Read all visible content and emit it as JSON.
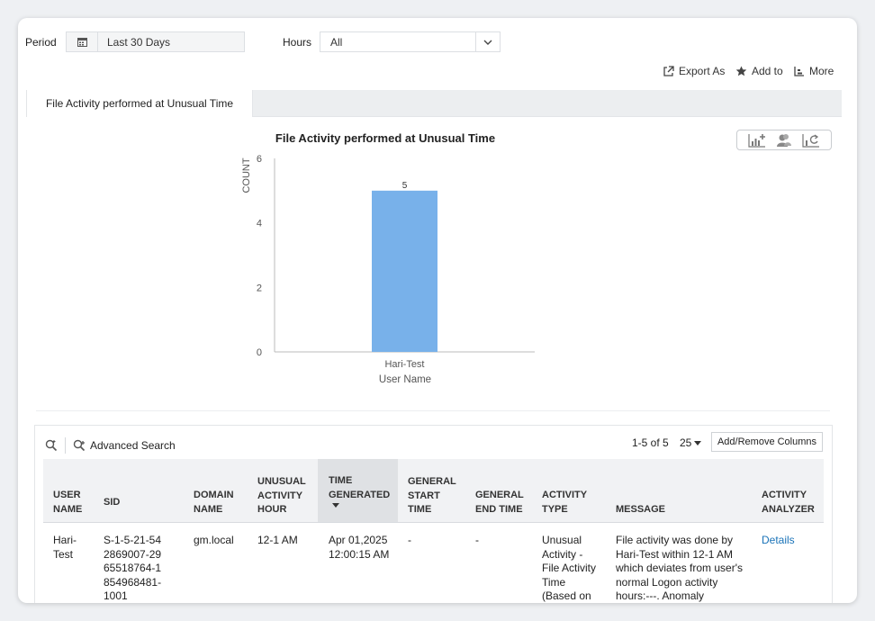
{
  "filters": {
    "period_label": "Period",
    "period_value": "Last 30 Days",
    "hours_label": "Hours",
    "hours_value": "All"
  },
  "toolbar": {
    "export_label": "Export As",
    "add_label": "Add to",
    "more_label": "More"
  },
  "tab": {
    "label": "File Activity performed at Unusual Time"
  },
  "chart_data": {
    "type": "bar",
    "title": "File Activity performed at Unusual Time",
    "xlabel": "User Name",
    "ylabel": "COUNT",
    "categories": [
      "Hari-Test"
    ],
    "values": [
      5
    ],
    "data_labels": [
      "5"
    ],
    "ylim": [
      0,
      6
    ],
    "yticks": [
      "0",
      "2",
      "4",
      "6"
    ],
    "bar_color": "#78b1ea",
    "grid": false
  },
  "grid": {
    "advanced_search_label": "Advanced Search",
    "pagination": "1-5 of 5",
    "page_size": "25",
    "add_remove_label": "Add/Remove Columns",
    "columns": [
      "USER NAME",
      "SID",
      "DOMAIN NAME",
      "UNUSUAL ACTIVITY HOUR",
      "TIME GENERATED",
      "GENERAL START TIME",
      "GENERAL END TIME",
      "ACTIVITY TYPE",
      "MESSAGE",
      "ACTIVITY ANALYZER"
    ],
    "row": {
      "user_name": "Hari-Test",
      "sid": "S-1-5-21-542869007-2965518764-1854968481-1001",
      "domain_name": "gm.local",
      "unusual_hour": "12-1 AM",
      "time_generated": "Apr 01,2025 12:00:15 AM",
      "general_start": "-",
      "general_end": "-",
      "activity_type": "Unusual Activity - File Activity Time (Based on",
      "message": "File activity was done by Hari-Test within 12-1 AM which deviates from user's normal Logon activity hours:---. Anomaly",
      "analyzer": "Details"
    }
  }
}
